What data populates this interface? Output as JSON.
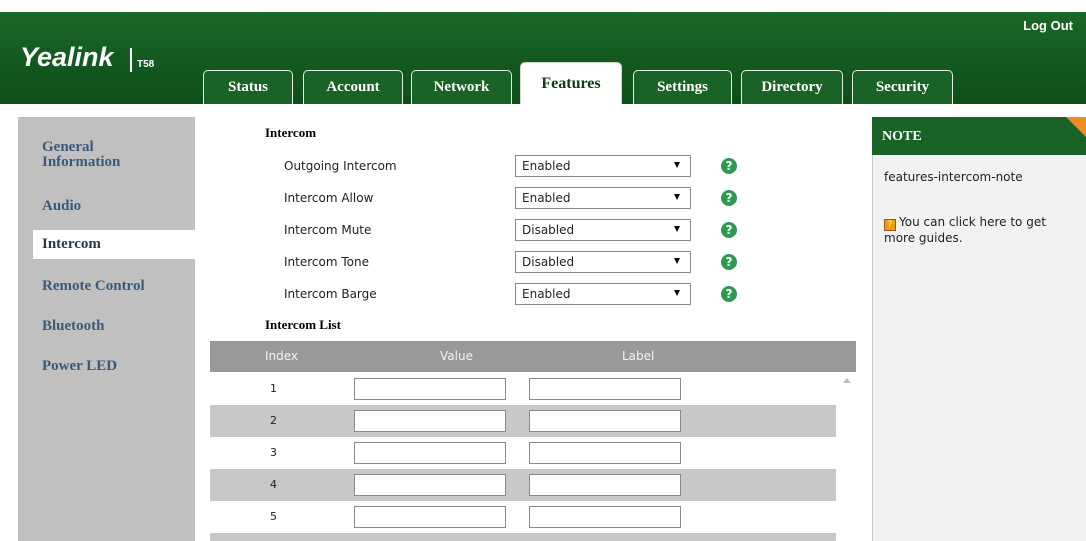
{
  "header": {
    "logo": "Yealink",
    "model": "T58",
    "logout_label": "Log Out",
    "tabs": [
      {
        "label": "Status"
      },
      {
        "label": "Account"
      },
      {
        "label": "Network"
      },
      {
        "label": "Features"
      },
      {
        "label": "Settings"
      },
      {
        "label": "Directory"
      },
      {
        "label": "Security"
      }
    ],
    "active_tab": "Features"
  },
  "sidebar": {
    "items": [
      {
        "label": "General Information"
      },
      {
        "label": "Audio"
      },
      {
        "label": "Intercom"
      },
      {
        "label": "Remote Control"
      },
      {
        "label": "Bluetooth"
      },
      {
        "label": "Power LED"
      }
    ],
    "active_item": "Intercom"
  },
  "intercom": {
    "title": "Intercom",
    "rows": [
      {
        "label": "Outgoing Intercom",
        "value": "Enabled"
      },
      {
        "label": "Intercom Allow",
        "value": "Enabled"
      },
      {
        "label": "Intercom Mute",
        "value": "Disabled"
      },
      {
        "label": "Intercom Tone",
        "value": "Disabled"
      },
      {
        "label": "Intercom Barge",
        "value": "Enabled"
      }
    ],
    "help_glyph": "?"
  },
  "intercom_list": {
    "title": "Intercom List",
    "columns": [
      "Index",
      "Value",
      "Label"
    ],
    "rows": [
      {
        "index": "1",
        "value": "",
        "label": ""
      },
      {
        "index": "2",
        "value": "",
        "label": ""
      },
      {
        "index": "3",
        "value": "",
        "label": ""
      },
      {
        "index": "4",
        "value": "",
        "label": ""
      },
      {
        "index": "5",
        "value": "",
        "label": ""
      }
    ]
  },
  "note": {
    "title": "NOTE",
    "text": "features-intercom-note",
    "guide_text": "You can click here to get more guides.",
    "guide_icon": "?"
  },
  "colors": {
    "header_green": "#1a6326",
    "help_green": "#2c9a4f",
    "note_corner": "#f08a24",
    "sidebar_gray": "#c0c0c0"
  }
}
